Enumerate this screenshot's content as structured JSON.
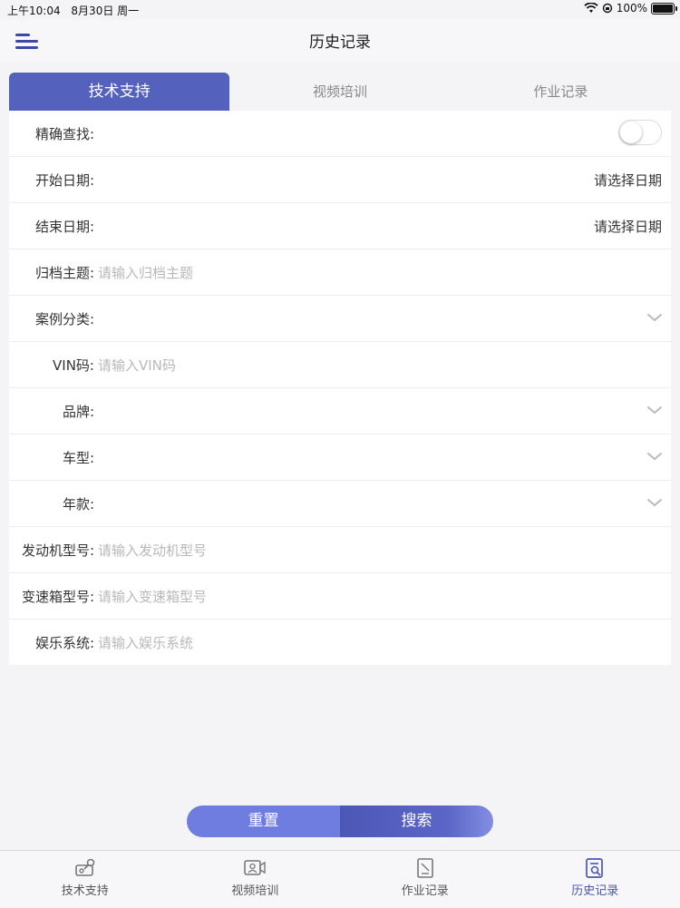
{
  "status_bar": {
    "time": "上午10:04",
    "date": "8月30日 周一",
    "battery": "100%"
  },
  "nav": {
    "title": "历史记录"
  },
  "tabs": [
    {
      "label": "技术支持",
      "active": true
    },
    {
      "label": "视频培训",
      "active": false
    },
    {
      "label": "作业记录",
      "active": false
    }
  ],
  "form": {
    "exact_search": {
      "label": "精确查找:",
      "toggle_on": false
    },
    "start_date": {
      "label": "开始日期:",
      "value": "请选择日期"
    },
    "end_date": {
      "label": "结束日期:",
      "value": "请选择日期"
    },
    "archive_subject": {
      "label": "归档主题:",
      "placeholder": "请输入归档主题"
    },
    "case_category": {
      "label": "案例分类:"
    },
    "vin": {
      "label": "VIN码:",
      "placeholder": "请输入VIN码"
    },
    "brand": {
      "label": "品牌:"
    },
    "model": {
      "label": "车型:"
    },
    "year": {
      "label": "年款:"
    },
    "engine_model": {
      "label": "发动机型号:",
      "placeholder": "请输入发动机型号"
    },
    "gearbox_model": {
      "label": "变速箱型号:",
      "placeholder": "请输入变速箱型号"
    },
    "entertainment": {
      "label": "娱乐系统:",
      "placeholder": "请输入娱乐系统"
    }
  },
  "buttons": {
    "reset": "重置",
    "search": "搜索"
  },
  "tabbar": [
    {
      "label": "技术支持",
      "icon": "tech-support-icon",
      "active": false
    },
    {
      "label": "视频培训",
      "icon": "video-training-icon",
      "active": false
    },
    {
      "label": "作业记录",
      "icon": "work-record-icon",
      "active": false
    },
    {
      "label": "历史记录",
      "icon": "history-icon",
      "active": true
    }
  ],
  "colors": {
    "accent": "#5461bd",
    "reset_button": "#6f7ce0",
    "placeholder": "#b8b8b8"
  }
}
